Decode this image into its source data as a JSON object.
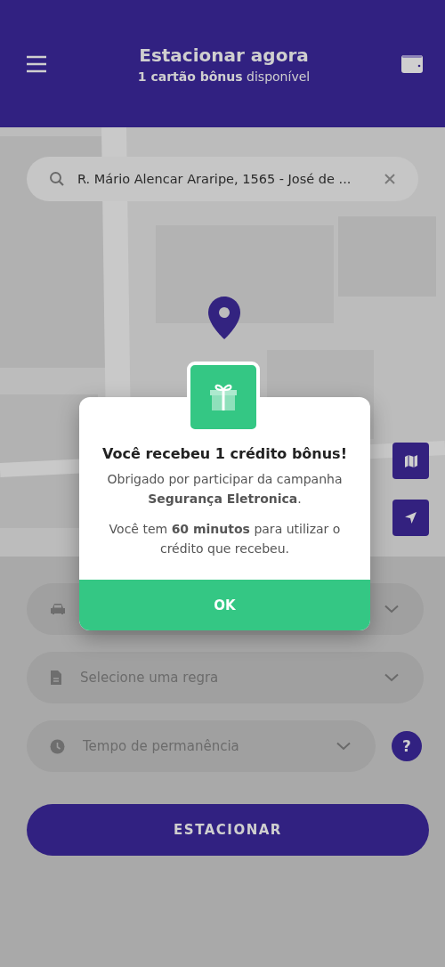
{
  "header": {
    "title": "Estacionar agora",
    "subtitle": "**1 cartão bônus** disponível"
  },
  "map": {
    "kind": "picture",
    "search": {
      "value": "R. Mário Alencar Araripe, 1565 - José de ..."
    }
  },
  "fields": [
    {
      "kind": "car"
    },
    {
      "kind": "document",
      "placeholder": "Selecione uma regra"
    },
    {
      "kind": "clock",
      "placeholder": "Tempo de permanência",
      "help": "?"
    }
  ],
  "primary_button": "ESTACIONAR",
  "dialog": {
    "title": "Você recebeu 1 crédito bônus!",
    "paragraphs": [
      "Obrigado por participar da campanha **Segurança Eletronica**.",
      "Você tem **60 minutos** para utilizar o crédito que recebeu."
    ],
    "button": "OK"
  }
}
